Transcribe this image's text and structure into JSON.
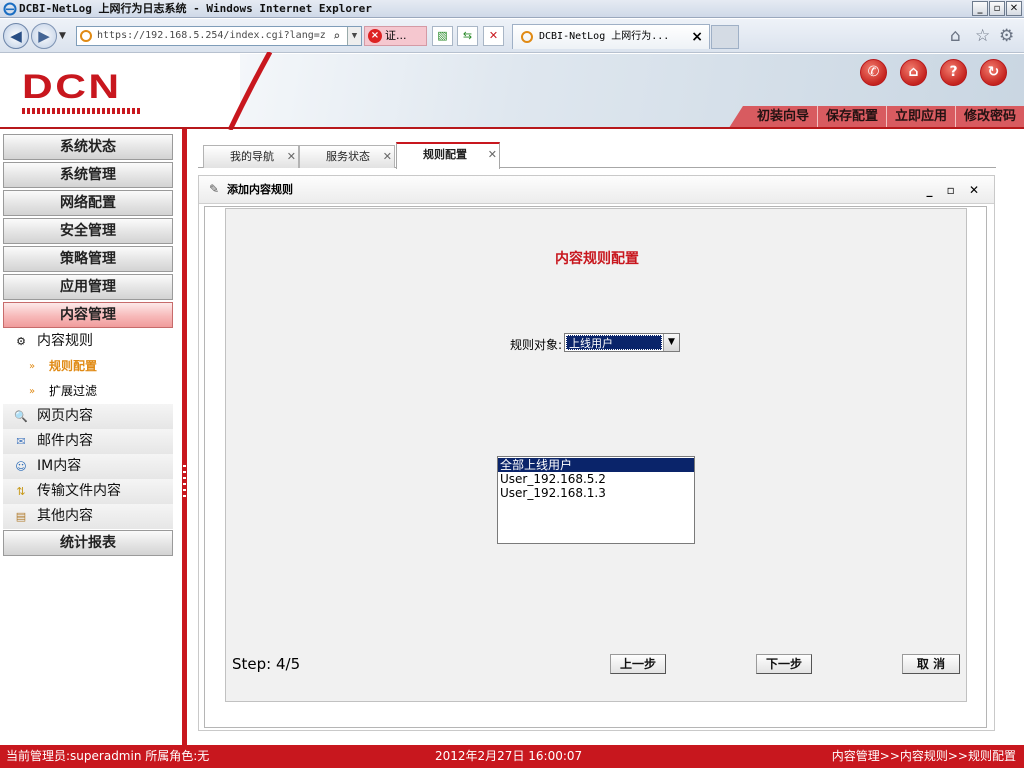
{
  "window": {
    "title": "DCBI-NetLog 上网行为日志系统 - Windows Internet Explorer"
  },
  "browser": {
    "url": "https://192.168.5.254/index.cgi?lang=z",
    "cert_error": "证...",
    "tab_title": "DCBI-NetLog 上网行为...",
    "back_icon": "back-arrow-icon",
    "forward_icon": "forward-arrow-icon"
  },
  "header": {
    "logo": "DCN",
    "menu": [
      "初装向导",
      "保存配置",
      "立即应用",
      "修改密码"
    ],
    "icons": [
      "phone-icon",
      "home-icon",
      "help-icon",
      "refresh-icon"
    ]
  },
  "sidebar": {
    "top_groups": [
      "系统状态",
      "系统管理",
      "网络配置",
      "安全管理",
      "策略管理",
      "应用管理"
    ],
    "active_group": "内容管理",
    "sub_items": [
      {
        "label": "内容规则",
        "icon": "gear-icon"
      },
      {
        "label": "网页内容",
        "icon": "magnifier-icon"
      },
      {
        "label": "邮件内容",
        "icon": "mail-icon"
      },
      {
        "label": "IM内容",
        "icon": "chat-icon"
      },
      {
        "label": "传输文件内容",
        "icon": "file-transfer-icon"
      },
      {
        "label": "其他内容",
        "icon": "clipboard-icon"
      }
    ],
    "leaf_items": [
      "规则配置",
      "扩展过滤"
    ],
    "selected_leaf": "规则配置",
    "bottom_group": "统计报表"
  },
  "tabs": [
    {
      "label": "我的导航"
    },
    {
      "label": "服务状态"
    },
    {
      "label": "规则配置"
    }
  ],
  "panel": {
    "title": "添加内容规则",
    "tools": "_ ▫ ✕",
    "content_title": "内容规则配置",
    "object_label": "规则对象:",
    "object_value": "上线用户",
    "users": [
      "全部上线用户",
      "User_192.168.5.2",
      "User_192.168.1.3"
    ],
    "step": "Step: 4/5",
    "prev_button": "上一步",
    "next_button": "下一步",
    "cancel_button": "取  消"
  },
  "status": {
    "left": "当前管理员:superadmin  所属角色:无",
    "center": "2012年2月27日 16:00:07",
    "right": "内容管理>>内容规则>>规则配置"
  },
  "colors": {
    "brand_red": "#c8171e",
    "selection_blue": "#0a246a",
    "accent_orange": "#e08a14"
  }
}
